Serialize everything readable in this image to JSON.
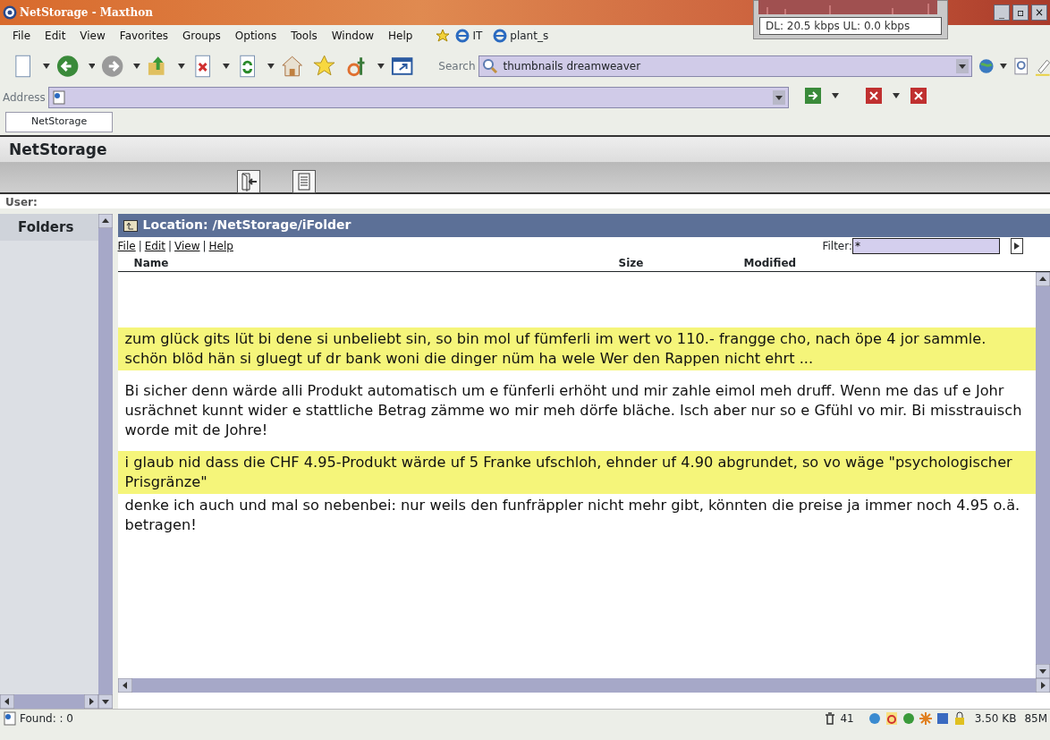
{
  "window": {
    "title": "NetStorage - Maxthon",
    "buttons": [
      "_",
      "▫",
      "×"
    ]
  },
  "net_monitor": {
    "reading": "DL: 20.5 kbps  UL: 0.0 kbps"
  },
  "menu": [
    "File",
    "Edit",
    "View",
    "Favorites",
    "Groups",
    "Options",
    "Tools",
    "Window",
    "Help"
  ],
  "links": [
    "IT",
    "plant_s"
  ],
  "search": {
    "label": "Search",
    "value": "thumbnails dreamweaver"
  },
  "address": {
    "label": "Address"
  },
  "tabs": [
    {
      "label": "NetStorage",
      "selected": true
    }
  ],
  "app": {
    "title": "NetStorage",
    "user_label": "User:"
  },
  "folders": {
    "title": "Folders"
  },
  "location": {
    "title": "Location: /NetStorage/iFolder",
    "menu": [
      "File",
      "Edit",
      "View",
      "Help"
    ],
    "separator": "|",
    "filter_label": "Filter:",
    "filter_value": "*"
  },
  "columns": [
    "Name",
    "Size",
    "Modified"
  ],
  "posts": [
    {
      "kind": "highlight",
      "text": "zum glück gits lüt bi dene si unbeliebt sin, so bin mol uf fümferli im wert vo 110.- frangge cho, nach öpe 4 jor sammle. schön blöd hän si gluegt uf dr bank woni die dinger nüm ha wele Wer den Rappen nicht ehrt ..."
    },
    {
      "kind": "plain",
      "text": "Bi sicher denn wärde alli Produkt automatisch um e fünferli erhöht und mir zahle eimol meh druff. Wenn me das uf e Johr usrächnet kunnt wider e stattliche Betrag zämme wo mir meh dörfe bläche. Isch aber nur so e Gfühl vo mir. Bi misstrauisch worde mit de Johre!"
    },
    {
      "kind": "highlight",
      "text": "i glaub nid dass die CHF 4.95-Produkt wärde uf 5 Franke ufschloh, ehnder uf 4.90 abgrundet, so vo wäge \"psychologischer Prisgränze\""
    },
    {
      "kind": "plain_tight",
      "text": "denke ich auch und mal so nebenbei: nur weils den funfräppler nicht mehr gibt, könnten die preise ja immer noch 4.95 o.ä. betragen!"
    }
  ],
  "status_bar": {
    "found": "Found: : 0",
    "count": "41",
    "size": "3.50 KB",
    "memory": "85M"
  }
}
